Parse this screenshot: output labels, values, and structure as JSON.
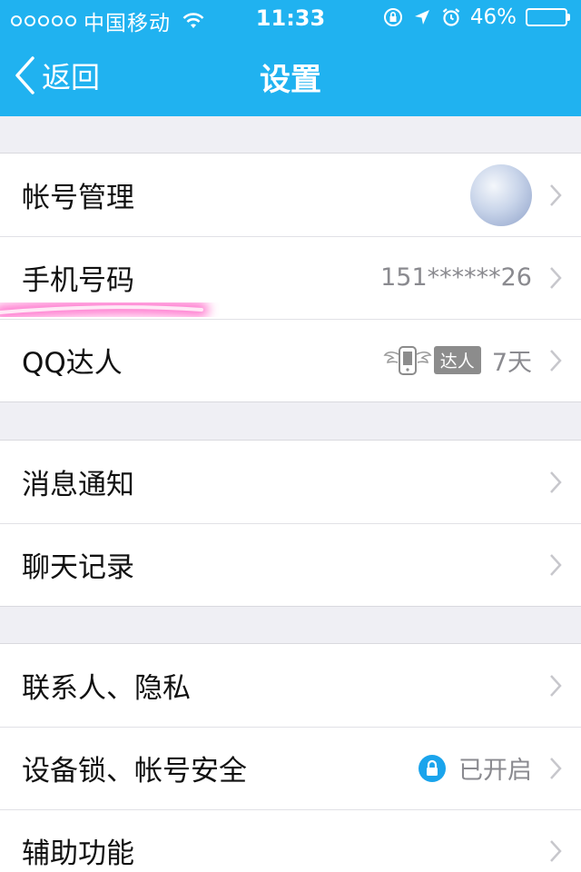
{
  "status_bar": {
    "carrier": "中国移动",
    "time": "11:33",
    "battery": "46%",
    "battery_fraction": 0.46
  },
  "nav": {
    "back_label": "返回",
    "title": "设置"
  },
  "groups": [
    {
      "rows": [
        {
          "label": "帐号管理",
          "accessory": "avatar"
        },
        {
          "label": "手机号码",
          "value": "151******26"
        },
        {
          "label": "QQ达人",
          "badge": "达人",
          "value": "7天"
        }
      ]
    },
    {
      "rows": [
        {
          "label": "消息通知"
        },
        {
          "label": "聊天记录"
        }
      ]
    },
    {
      "rows": [
        {
          "label": "联系人、隐私"
        },
        {
          "label": "设备锁、帐号安全",
          "value": "已开启"
        },
        {
          "label": "辅助功能"
        }
      ]
    }
  ],
  "colors": {
    "nav_blue": "#20b2f0",
    "background": "#efeff4",
    "lock_blue": "#1aa4ec",
    "highlight_pink": "#ff4fc0"
  }
}
